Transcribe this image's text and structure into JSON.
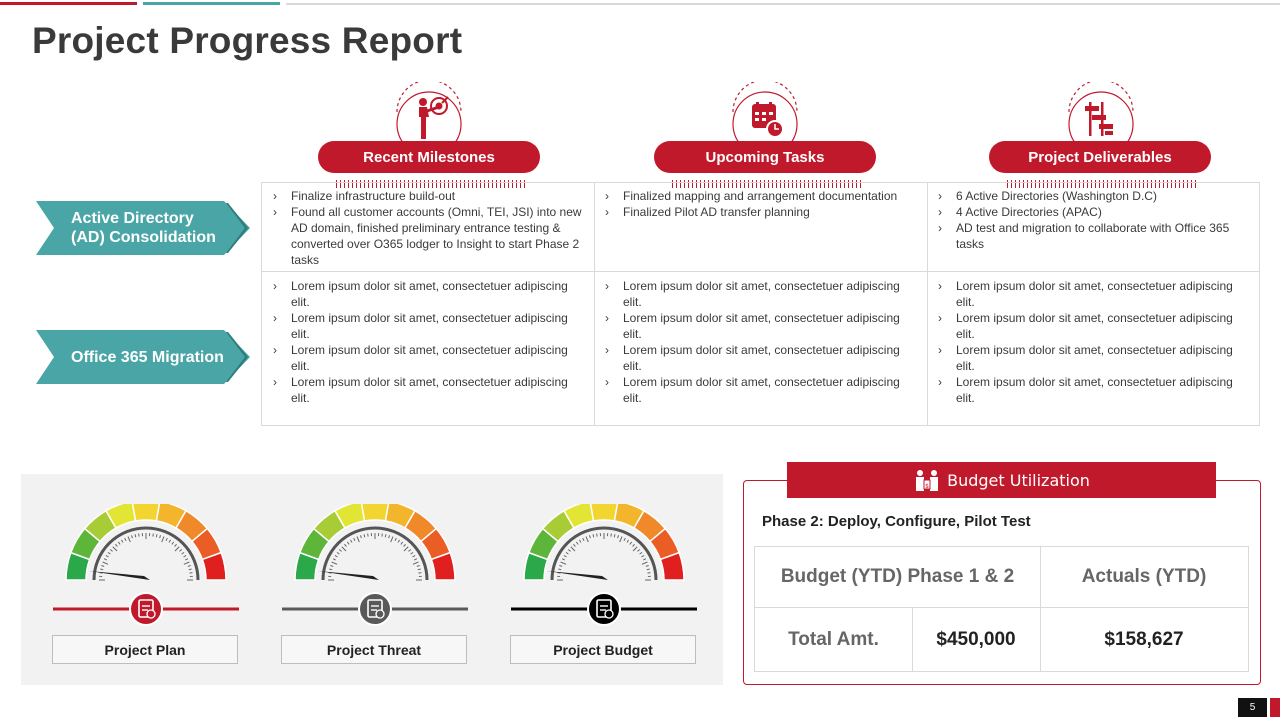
{
  "title": "Project Progress Report",
  "columns": [
    {
      "label": "Recent Milestones",
      "icon": "target-person-icon"
    },
    {
      "label": "Upcoming Tasks",
      "icon": "calendar-clock-icon"
    },
    {
      "label": "Project Deliverables",
      "icon": "gantt-chart-icon"
    }
  ],
  "rows": [
    {
      "label": "Active Directory (AD) Consolidation",
      "cells": [
        [
          "Finalize infrastructure  build-out",
          "Found all customer accounts (Omni, TEI, JSI) into new AD domain, finished  preliminary entrance testing & converted   over O365  lodger to Insight to start Phase 2 tasks"
        ],
        [
          "Finalized mapping and arrangement documentation",
          "Finalized Pilot AD transfer  planning"
        ],
        [
          "6 Active Directories (Washington D.C)",
          "4 Active Directories (APAC)",
          "AD test and migration to collaborate with Office 365 tasks"
        ]
      ]
    },
    {
      "label": "Office 365 Migration",
      "cells": [
        [
          "Lorem ipsum dolor  sit amet, consectetuer adipiscing elit.",
          "Lorem ipsum dolor  sit amet, consectetuer adipiscing elit.",
          "Lorem ipsum dolor  sit amet, consectetuer adipiscing elit.",
          "Lorem ipsum dolor  sit amet, consectetuer adipiscing elit."
        ],
        [
          "Lorem ipsum dolor  sit amet, consectetuer adipiscing elit.",
          "Lorem ipsum dolor  sit amet, consectetuer adipiscing elit.",
          "Lorem ipsum dolor  sit amet, consectetuer adipiscing elit.",
          "Lorem ipsum dolor  sit amet, consectetuer adipiscing elit."
        ],
        [
          "Lorem ipsum dolor  sit amet, consectetuer adipiscing elit.",
          "Lorem ipsum dolor  sit amet, consectetuer adipiscing elit.",
          "Lorem ipsum dolor  sit amet, consectetuer adipiscing elit.",
          "Lorem ipsum dolor  sit amet, consectetuer adipiscing elit."
        ]
      ]
    }
  ],
  "gauges": [
    {
      "label": "Project Plan",
      "icon": "clipboard-clock-icon",
      "level": 0.15,
      "accent": "#c0192c"
    },
    {
      "label": "Project Threat",
      "icon": "clipboard-warning-icon",
      "level": 0.15,
      "accent": "#595959"
    },
    {
      "label": "Project Budget",
      "icon": "budget-warning-icon",
      "level": 0.15,
      "accent": "#000000"
    }
  ],
  "budget": {
    "title": "Budget Utilization",
    "icon": "budget-people-icon",
    "phase": "Phase 2: Deploy, Configure, Pilot Test",
    "header_left": "Budget (YTD) Phase 1 & 2",
    "header_right": "Actuals (YTD)",
    "row_label": "Total Amt.",
    "budget_value": "$450,000",
    "actual_value": "$158,627"
  },
  "page_number": "5",
  "colors": {
    "brand_red": "#c0192c",
    "teal": "#4aa6a6",
    "panel_gray": "#f2f2f2"
  }
}
